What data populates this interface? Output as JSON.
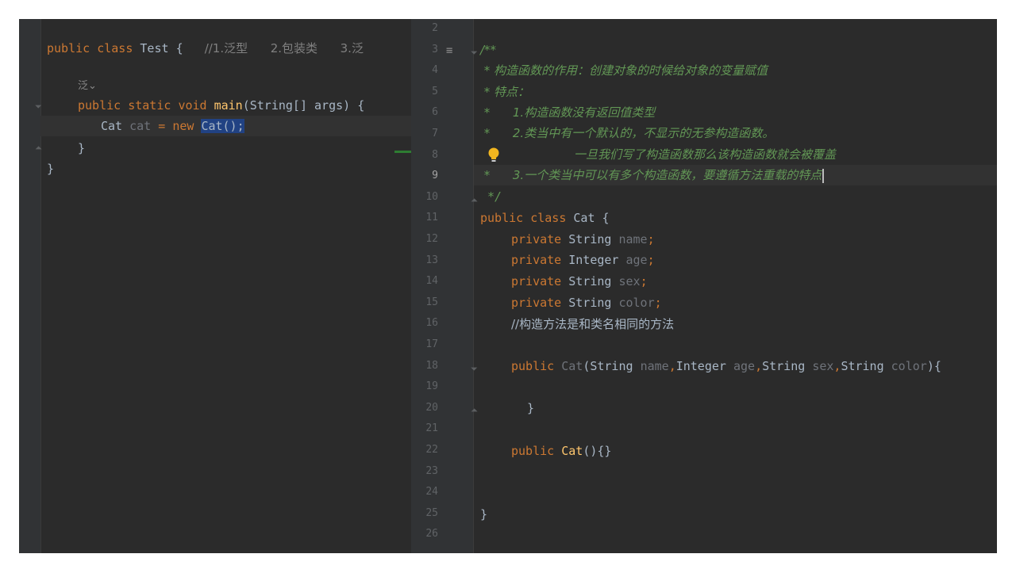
{
  "left_editor": {
    "line1": {
      "kw1": "public",
      "kw2": "class",
      "name": "Test",
      "brace": "{",
      "comment": "//1.泛型      2.包装类      3.泛"
    },
    "inlay_hint": "泛⌄",
    "line3": {
      "kw1": "public",
      "kw2": "static",
      "kw3": "void",
      "method": "main",
      "params": "(String[] args) {"
    },
    "line4": {
      "type": "Cat",
      "var": "cat",
      "eq": "=",
      "kw": "new",
      "call": "Cat();"
    },
    "line5": {
      "brace": "}"
    },
    "line6": {
      "brace": "}"
    }
  },
  "right_editor": {
    "line_numbers": [
      "2",
      "3",
      "4",
      "5",
      "6",
      "7",
      "8",
      "9",
      "10",
      "11",
      "12",
      "13",
      "14",
      "15",
      "16",
      "17",
      "18",
      "19",
      "20",
      "21",
      "22",
      "23",
      "24",
      "25",
      "26"
    ],
    "active_line": "9",
    "doc": {
      "open": "/**",
      "l4": " * 构造函数的作用：创建对象的时候给对象的变量赋值",
      "l5": " * 特点：",
      "l6_star": " *",
      "l6_text": "1.构造函数没有返回值类型",
      "l7_star": " *",
      "l7_text": "2.类当中有一个默认的，不显示的无参构造函数。",
      "l8_text": "一旦我们写了构造函数那么该构造函数就会被覆盖",
      "l9_star": " *",
      "l9_text": "3.一个类当中可以有多个构造函数，要遵循方法重载的特点",
      "close": " */"
    },
    "class_decl": {
      "kw1": "public",
      "kw2": "class",
      "name": "Cat",
      "brace": "{"
    },
    "fields": [
      {
        "mod": "private",
        "type": "String",
        "name": "name",
        "semi": ";"
      },
      {
        "mod": "private",
        "type": "Integer",
        "name": "age",
        "semi": ";"
      },
      {
        "mod": "private",
        "type": "String",
        "name": "sex",
        "semi": ";"
      },
      {
        "mod": "private",
        "type": "String",
        "name": "color",
        "semi": ";"
      }
    ],
    "comment": "//构造方法是和类名相同的方法",
    "ctor1": {
      "kw": "public",
      "name": "Cat",
      "p1t": "String",
      "p1": "name",
      "p2t": "Integer",
      "p2": "age",
      "p3t": "String",
      "p3": "sex",
      "p4t": "String",
      "p4": "color",
      "end": "){"
    },
    "ctor1_close": "}",
    "ctor2": {
      "kw": "public",
      "name": "Cat",
      "rest": "(){}"
    },
    "class_close": "}"
  },
  "colors": {
    "background": "#2b2b2b",
    "keyword": "#cc7832",
    "doc_comment": "#629755",
    "field": "#9876aa",
    "selection": "#214283"
  }
}
